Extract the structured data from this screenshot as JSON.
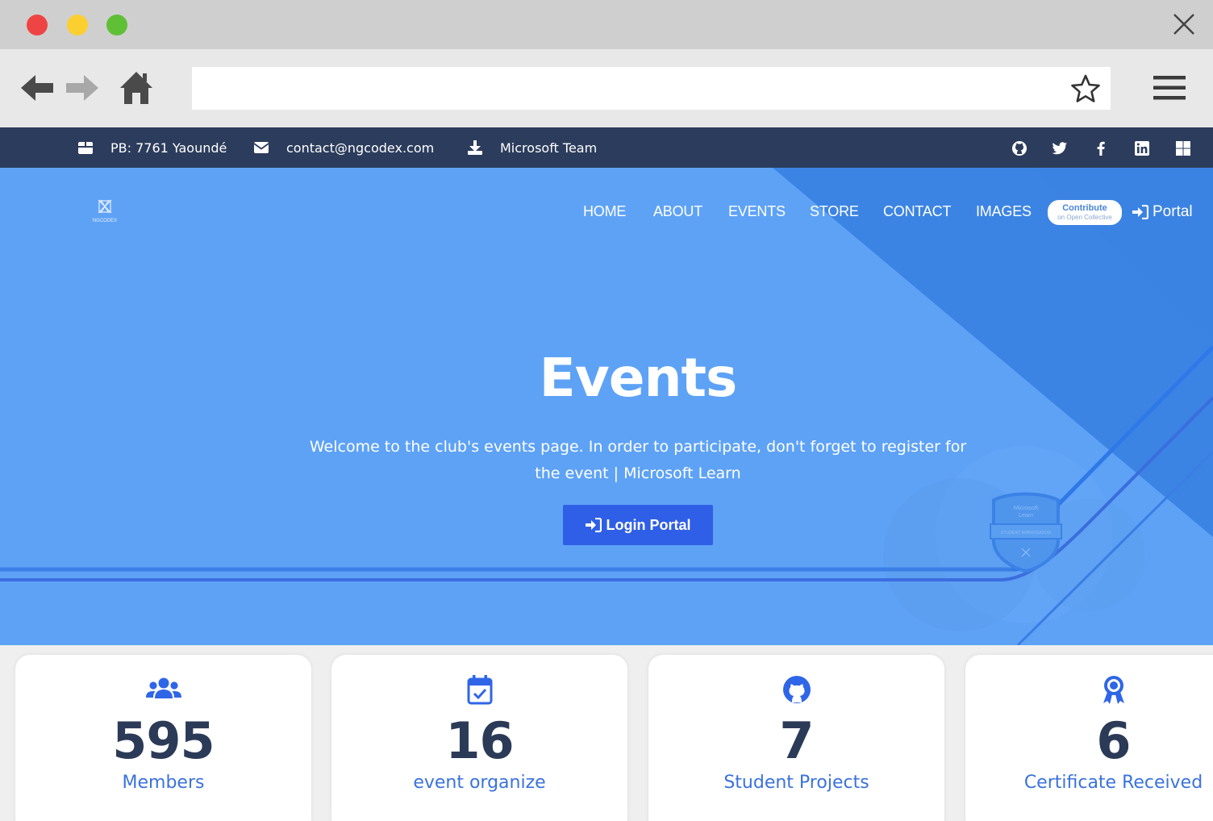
{
  "info_bar": {
    "address": "PB: 7761 Yaoundé",
    "email": "contact@ngcodex.com",
    "team": "Microsoft Team",
    "social_icons": [
      "github-icon",
      "twitter-icon",
      "facebook-icon",
      "linkedin-icon",
      "windows-icon"
    ]
  },
  "nav": {
    "logo_text": "NGCODEX",
    "links": [
      "HOME",
      "ABOUT",
      "EVENTS",
      "STORE",
      "CONTACT",
      "IMAGES"
    ],
    "contribute_label": "Contribute",
    "contribute_sub": "on Open Collective",
    "portal_label": "Portal"
  },
  "hero": {
    "title": "Events",
    "subtitle": "Welcome to the club's events page. In order to participate, don't forget to register for the event | Microsoft Learn",
    "button_label": "Login Portal",
    "badge_line1": "Microsoft",
    "badge_line2": "Learn",
    "badge_line3": "STUDENT AMBASSADOR"
  },
  "stats": [
    {
      "icon": "users-icon",
      "value": "595",
      "label": "Members"
    },
    {
      "icon": "calendar-check-icon",
      "value": "16",
      "label": "event organize"
    },
    {
      "icon": "github-icon",
      "value": "7",
      "label": "Student Projects"
    },
    {
      "icon": "award-icon",
      "value": "6",
      "label": "Certificate Received"
    }
  ],
  "colors": {
    "info_bar_bg": "#2c3c5c",
    "hero_bg": "#5ea2f6",
    "accent": "#2f5fe6",
    "stat_value": "#2b3a57",
    "stat_label": "#3a72dc"
  }
}
